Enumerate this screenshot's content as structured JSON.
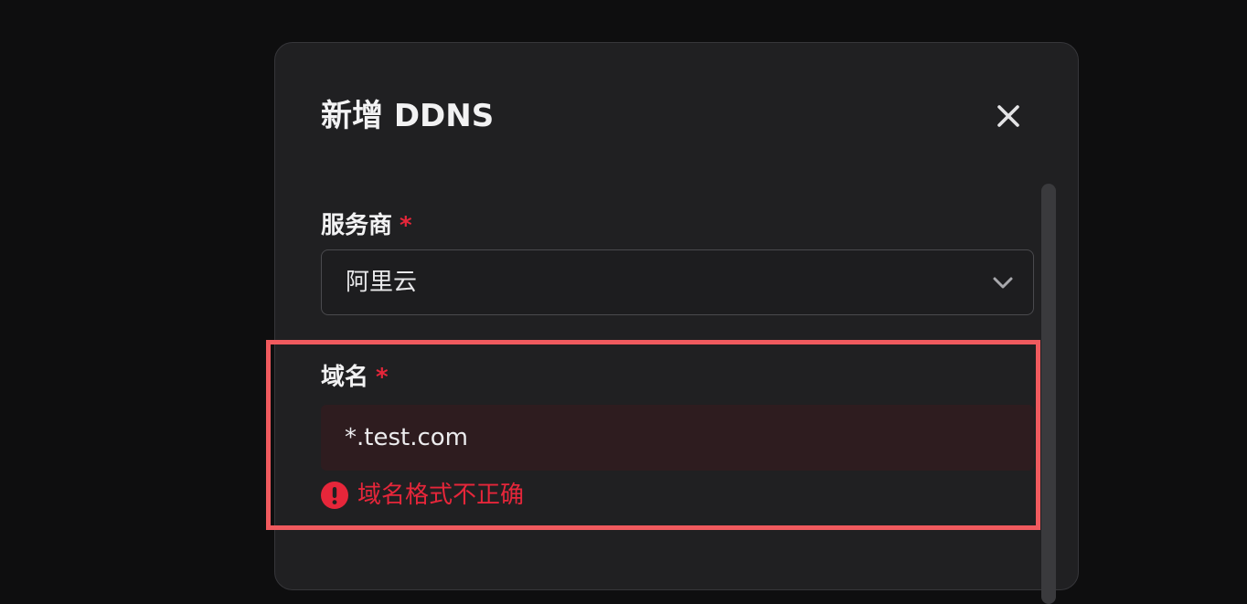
{
  "dialog": {
    "title": "新增 DDNS",
    "close_icon": "close-icon"
  },
  "provider": {
    "label": "服务商",
    "required_mark": "*",
    "value": "阿里云",
    "dropdown_icon": "chevron-down-icon"
  },
  "domain": {
    "label": "域名",
    "required_mark": "*",
    "value": "*.test.com",
    "error_icon": "exclamation-circle-icon",
    "error_message": "域名格式不正确"
  },
  "colors": {
    "required": "#e6263a",
    "error": "#e6263a",
    "input_error_bg": "#2e1c1f",
    "highlight": "#f05a5e",
    "dialog_bg": "#202022",
    "page_bg": "#0e0e0f"
  }
}
